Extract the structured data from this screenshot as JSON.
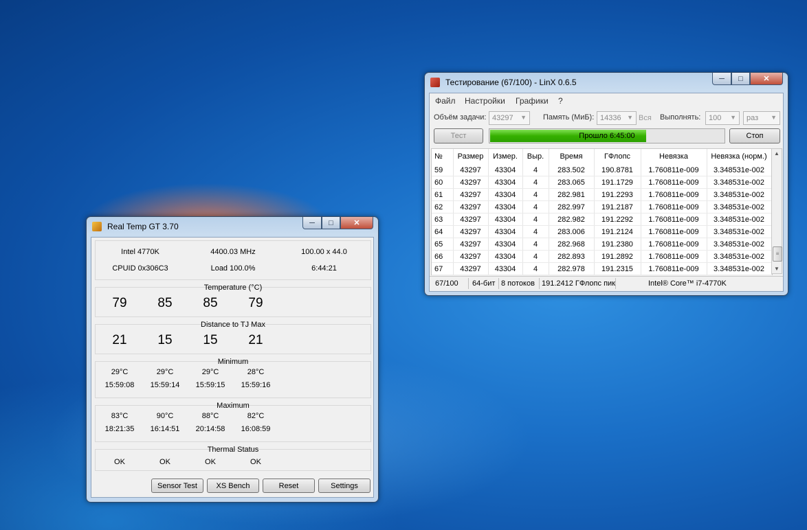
{
  "realtemp": {
    "title": "Real Temp GT 3.70",
    "cpu": "Intel 4770K",
    "freq": "4400.03 MHz",
    "mult": "100.00 x 44.0",
    "cpuid": "CPUID  0x306C3",
    "load": "Load 100.0%",
    "uptime": "6:44:21",
    "temp_title": "Temperature (°C)",
    "temps": [
      "79",
      "85",
      "85",
      "79"
    ],
    "dist_title": "Distance to TJ Max",
    "dists": [
      "21",
      "15",
      "15",
      "21"
    ],
    "min_title": "Minimum",
    "min_vals": [
      "29°C",
      "29°C",
      "29°C",
      "28°C"
    ],
    "min_times": [
      "15:59:08",
      "15:59:14",
      "15:59:15",
      "15:59:16"
    ],
    "max_title": "Maximum",
    "max_vals": [
      "83°C",
      "90°C",
      "88°C",
      "82°C"
    ],
    "max_times": [
      "18:21:35",
      "16:14:51",
      "20:14:58",
      "16:08:59"
    ],
    "thermal_title": "Thermal Status",
    "thermal": [
      "OK",
      "OK",
      "OK",
      "OK"
    ],
    "buttons": {
      "sensor_test": "Sensor Test",
      "xs_bench": "XS Bench",
      "reset": "Reset",
      "settings": "Settings"
    }
  },
  "linx": {
    "title": "Тестирование (67/100) - LinX 0.6.5",
    "menu": [
      "Файл",
      "Настройки",
      "Графики",
      "?"
    ],
    "task_label": "Объём задачи:",
    "task_value": "43297",
    "memory_label": "Память (МиБ):",
    "memory_value": "14336",
    "all_label": "Вся",
    "run_label": "Выполнять:",
    "run_value": "100",
    "times_value": "раз",
    "test_button": "Тест",
    "progress_text": "Прошло 6:45:00",
    "progress_fraction": 0.67,
    "stop_button": "Стоп",
    "columns": [
      "№",
      "Размер",
      "Измер.",
      "Выр.",
      "Время",
      "ГФлопс",
      "Невязка",
      "Невязка (норм.)"
    ],
    "rows": [
      [
        "59",
        "43297",
        "43304",
        "4",
        "283.502",
        "190.8781",
        "1.760811e-009",
        "3.348531e-002"
      ],
      [
        "60",
        "43297",
        "43304",
        "4",
        "283.065",
        "191.1729",
        "1.760811e-009",
        "3.348531e-002"
      ],
      [
        "61",
        "43297",
        "43304",
        "4",
        "282.981",
        "191.2293",
        "1.760811e-009",
        "3.348531e-002"
      ],
      [
        "62",
        "43297",
        "43304",
        "4",
        "282.997",
        "191.2187",
        "1.760811e-009",
        "3.348531e-002"
      ],
      [
        "63",
        "43297",
        "43304",
        "4",
        "282.982",
        "191.2292",
        "1.760811e-009",
        "3.348531e-002"
      ],
      [
        "64",
        "43297",
        "43304",
        "4",
        "283.006",
        "191.2124",
        "1.760811e-009",
        "3.348531e-002"
      ],
      [
        "65",
        "43297",
        "43304",
        "4",
        "282.968",
        "191.2380",
        "1.760811e-009",
        "3.348531e-002"
      ],
      [
        "66",
        "43297",
        "43304",
        "4",
        "282.893",
        "191.2892",
        "1.760811e-009",
        "3.348531e-002"
      ],
      [
        "67",
        "43297",
        "43304",
        "4",
        "282.978",
        "191.2315",
        "1.760811e-009",
        "3.348531e-002"
      ]
    ],
    "status": {
      "count": "67/100",
      "bits": "64-бит",
      "threads": "8 потоков",
      "peak": "191.2412 ГФлопс пик",
      "cpu": "Intel® Core™ i7-4770K"
    }
  },
  "colors": {
    "progress_green": "#36b000",
    "title_bar": "#b9d1ea",
    "close_red": "#c0503a"
  }
}
